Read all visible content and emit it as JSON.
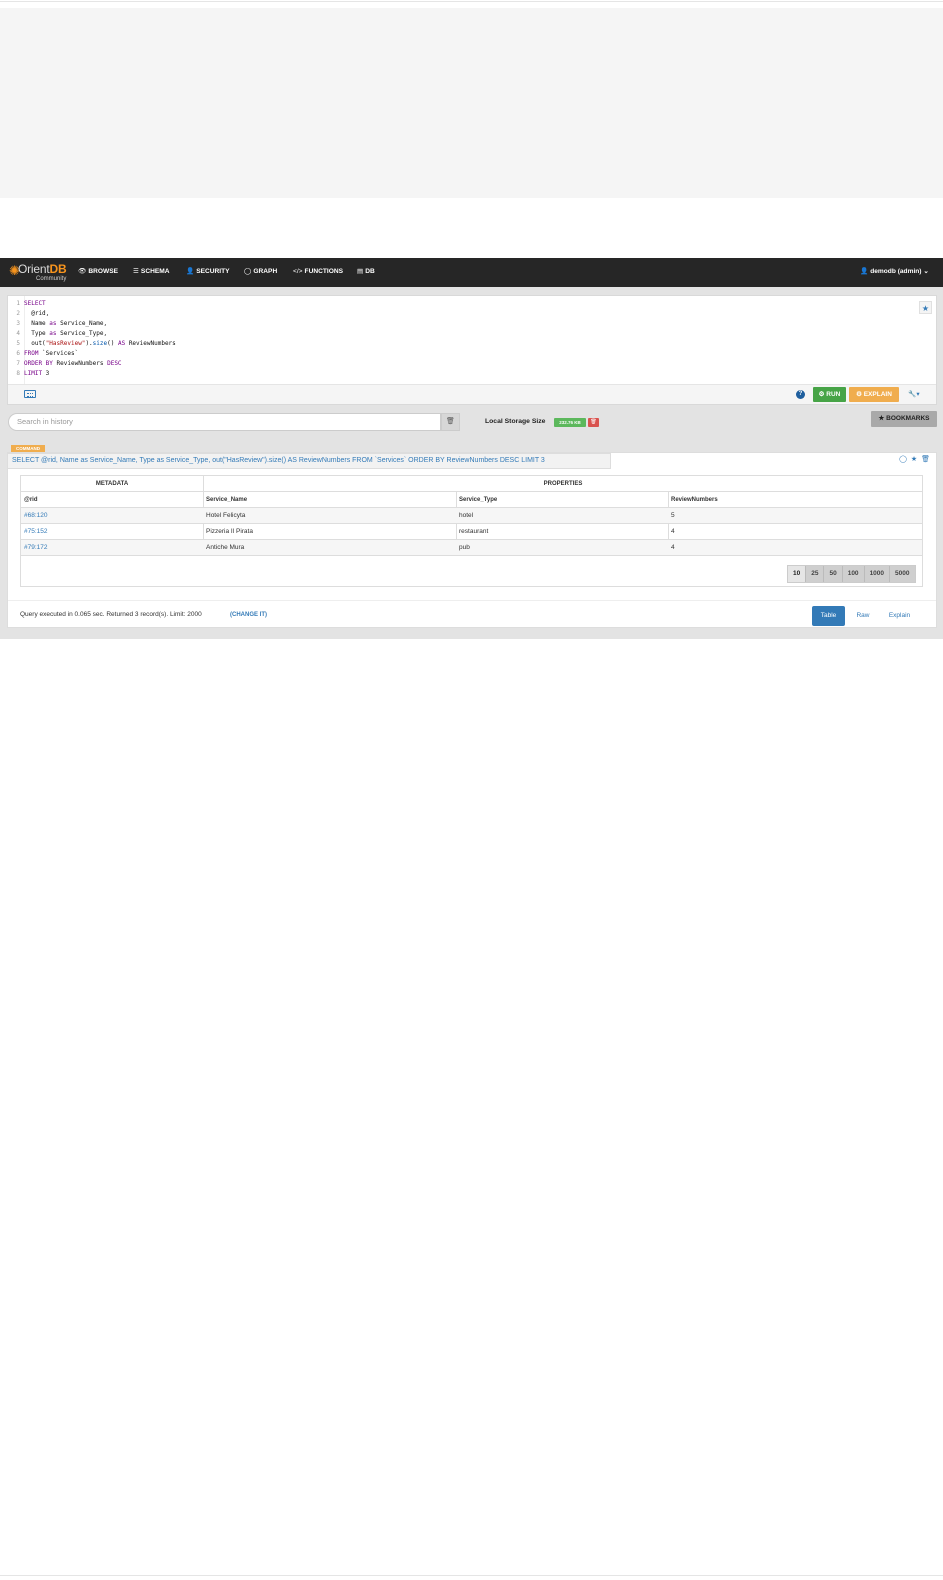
{
  "brand": {
    "name_part1": "Orient",
    "name_part2": "DB",
    "sub": "Community"
  },
  "nav": {
    "items": [
      {
        "icon": "👁",
        "label": "BROWSE"
      },
      {
        "icon": "☰",
        "label": "SCHEMA"
      },
      {
        "icon": "👤",
        "label": "SECURITY"
      },
      {
        "icon": "◯",
        "label": "GRAPH"
      },
      {
        "icon": "</>",
        "label": "FUNCTIONS"
      },
      {
        "icon": "▤",
        "label": "DB"
      }
    ],
    "user": {
      "icon": "👤",
      "label": "demodb (admin)",
      "caret": "⌄"
    }
  },
  "editor": {
    "lines": [
      {
        "n": "1",
        "t": [
          [
            "kw",
            "SELECT"
          ]
        ]
      },
      {
        "n": "2",
        "t": [
          [
            "plain",
            "  @rid,"
          ]
        ]
      },
      {
        "n": "3",
        "t": [
          [
            "plain",
            "  Name "
          ],
          [
            "kw",
            "as"
          ],
          [
            "plain",
            " Service_Name,"
          ]
        ]
      },
      {
        "n": "4",
        "t": [
          [
            "plain",
            "  Type "
          ],
          [
            "kw",
            "as"
          ],
          [
            "plain",
            " Service_Type,"
          ]
        ]
      },
      {
        "n": "5",
        "t": [
          [
            "plain",
            "  out("
          ],
          [
            "str",
            "\"HasReview\""
          ],
          [
            "plain",
            ")."
          ],
          [
            "fn",
            "size"
          ],
          [
            "plain",
            "() "
          ],
          [
            "kw",
            "AS"
          ],
          [
            "plain",
            " ReviewNumbers"
          ]
        ]
      },
      {
        "n": "6",
        "t": [
          [
            "kw",
            "FROM"
          ],
          [
            "plain",
            " `Services`"
          ]
        ]
      },
      {
        "n": "7",
        "t": [
          [
            "kw",
            "ORDER BY"
          ],
          [
            "plain",
            " ReviewNumbers "
          ],
          [
            "kw",
            "DESC"
          ]
        ]
      },
      {
        "n": "8",
        "t": [
          [
            "kw",
            "LIMIT"
          ],
          [
            "plain",
            " 3"
          ]
        ]
      }
    ],
    "help_icon": "?",
    "run_label": "⚙ RUN",
    "explain_label": "⚙ EXPLAIN",
    "tools_label": "🔧▾",
    "bookmark_star": "★"
  },
  "history": {
    "search_placeholder": "Search in history",
    "trash_icon": "🗑",
    "storage_label": "Local Storage Size",
    "storage_size": "232.76 KB",
    "storage_delete_icon": "🗑",
    "bookmarks_label": "★ BOOKMARKS"
  },
  "result": {
    "badge": "COMMAND",
    "command": "SELECT @rid, Name as Service_Name, Type as Service_Type, out(\"HasReview\").size() AS ReviewNumbers FROM `Services` ORDER BY ReviewNumbers DESC LIMIT 3",
    "actions": {
      "graph": "◯",
      "star": "★",
      "trash": "🗑"
    },
    "headers": {
      "metadata": "METADATA",
      "properties": "PROPERTIES"
    },
    "columns": [
      "@rid",
      "Service_Name",
      "Service_Type",
      "ReviewNumbers"
    ],
    "rows": [
      [
        "#68:120",
        "Hotel Felicyta",
        "hotel",
        "5"
      ],
      [
        "#75:152",
        "Pizzeria Il Pirata",
        "restaurant",
        "4"
      ],
      [
        "#79:172",
        "Antiche Mura",
        "pub",
        "4"
      ]
    ],
    "page_sizes": [
      "10",
      "25",
      "50",
      "100",
      "1000",
      "5000"
    ],
    "active_page_size": "10",
    "footer_text": "Query executed in 0.065 sec. Returned 3 record(s). Limit: 2000",
    "change_label": "(CHANGE IT)",
    "views": {
      "table": "Table",
      "raw": "Raw",
      "explain": "Explain"
    },
    "active_view": "Table"
  },
  "colors": {
    "navbar": "#262626",
    "brand_orange": "#f7941d",
    "link_blue": "#337ab7",
    "run_green": "#47a447",
    "explain_orange": "#f0ad4e"
  }
}
